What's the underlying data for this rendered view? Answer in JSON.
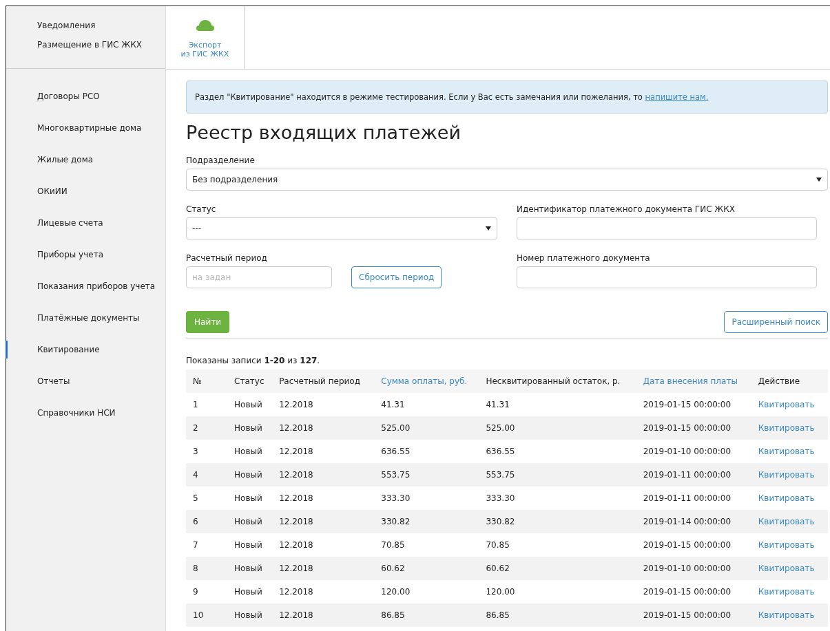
{
  "sidebar": {
    "top_items": [
      {
        "label": "Уведомления"
      },
      {
        "label": "Размещение в ГИС ЖКХ"
      }
    ],
    "items": [
      {
        "label": "Договоры РСО",
        "selected": false
      },
      {
        "label": "Многоквартирные дома",
        "selected": false
      },
      {
        "label": "Жилые дома",
        "selected": false
      },
      {
        "label": "ОКиИИ",
        "selected": false
      },
      {
        "label": "Лицевые счета",
        "selected": false
      },
      {
        "label": "Приборы учета",
        "selected": false
      },
      {
        "label": "Показания приборов учета",
        "selected": false
      },
      {
        "label": "Платёжные документы",
        "selected": false
      },
      {
        "label": "Квитирование",
        "selected": true
      },
      {
        "label": "Отчеты",
        "selected": false
      },
      {
        "label": "Справочники НСИ",
        "selected": false
      }
    ]
  },
  "toolbar": {
    "tiles": [
      {
        "label_lines": [
          "Экспорт",
          "из ГИС ЖКХ"
        ]
      }
    ]
  },
  "alert": {
    "text": "Раздел \"Квитирование\" находится в режиме тестирования. Если у Вас есть замечания или пожелания, то",
    "link": "напишите нам."
  },
  "title": "Реестр входящих платежей",
  "filters": {
    "subdivision": {
      "label": "Подразделение",
      "value": "Без подразделения"
    },
    "status": {
      "label": "Статус",
      "value": "---"
    },
    "document_id": {
      "label": "Идентификатор платежного документа ГИС ЖКХ"
    },
    "period": {
      "label": "Расчетный период",
      "placeholder": "на задан",
      "reset_button": "Сбросить период"
    },
    "document_number": {
      "label": "Номер платежного документа"
    },
    "find_button": "Найти",
    "advanced_button": "Расширенный поиск"
  },
  "summary": "Показаны записи **1-20** из **127**.",
  "table": {
    "columns": [
      {
        "label": "№",
        "sortable": false
      },
      {
        "label": "Статус",
        "sortable": false
      },
      {
        "label": "Расчетный период",
        "sortable": false
      },
      {
        "label": "Сумма оплаты, руб.",
        "sortable": true
      },
      {
        "label": "Несквитированный остаток, р.",
        "sortable": false
      },
      {
        "label": "Дата внесения платы",
        "sortable": true
      },
      {
        "label": "Действие",
        "sortable": false
      }
    ],
    "rows": [
      {
        "cells": [
          "1",
          "Новый",
          "12.2018",
          "41.31",
          "41.31",
          "2019-01-15 00:00:00"
        ],
        "action": "Квитировать"
      },
      {
        "cells": [
          "2",
          "Новый",
          "12.2018",
          "525.00",
          "525.00",
          "2019-01-15 00:00:00"
        ],
        "action": "Квитировать"
      },
      {
        "cells": [
          "3",
          "Новый",
          "12.2018",
          "636.55",
          "636.55",
          "2019-01-10 00:00:00"
        ],
        "action": "Квитировать"
      },
      {
        "cells": [
          "4",
          "Новый",
          "12.2018",
          "553.75",
          "553.75",
          "2019-01-11 00:00:00"
        ],
        "action": "Квитировать"
      },
      {
        "cells": [
          "5",
          "Новый",
          "12.2018",
          "333.30",
          "333.30",
          "2019-01-11 00:00:00"
        ],
        "action": "Квитировать"
      },
      {
        "cells": [
          "6",
          "Новый",
          "12.2018",
          "330.82",
          "330.82",
          "2019-01-14 00:00:00"
        ],
        "action": "Квитировать"
      },
      {
        "cells": [
          "7",
          "Новый",
          "12.2018",
          "70.85",
          "70.85",
          "2019-01-15 00:00:00"
        ],
        "action": "Квитировать"
      },
      {
        "cells": [
          "8",
          "Новый",
          "12.2018",
          "60.62",
          "60.62",
          "2019-01-10 00:00:00"
        ],
        "action": "Квитировать"
      },
      {
        "cells": [
          "9",
          "Новый",
          "12.2018",
          "120.00",
          "120.00",
          "2019-01-15 00:00:00"
        ],
        "action": "Квитировать"
      },
      {
        "cells": [
          "10",
          "Новый",
          "12.2018",
          "86.85",
          "86.85",
          "2019-01-15 00:00:00"
        ],
        "action": "Квитировать"
      }
    ]
  }
}
